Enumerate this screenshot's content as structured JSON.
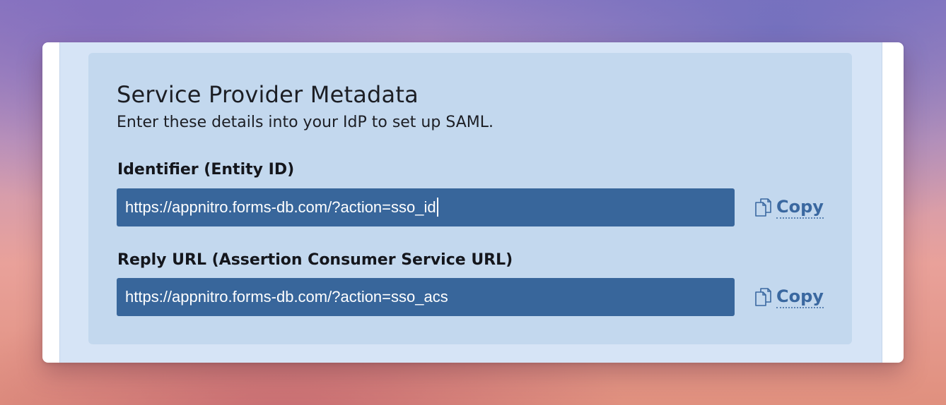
{
  "panel": {
    "title": "Service Provider Metadata",
    "subtitle": "Enter these details into your IdP to set up SAML."
  },
  "fields": [
    {
      "label": "Identifier (Entity ID)",
      "value": "https://appnitro.forms-db.com/?action=sso_id",
      "copy_label": "Copy",
      "copy_icon": "copy-icon"
    },
    {
      "label": "Reply URL (Assertion Consumer Service URL)",
      "value": "https://appnitro.forms-db.com/?action=sso_acs",
      "copy_label": "Copy",
      "copy_icon": "copy-icon"
    }
  ],
  "colors": {
    "input_bg": "#38669b",
    "panel_bg": "#c3d8ee",
    "accent": "#3a68a0"
  }
}
